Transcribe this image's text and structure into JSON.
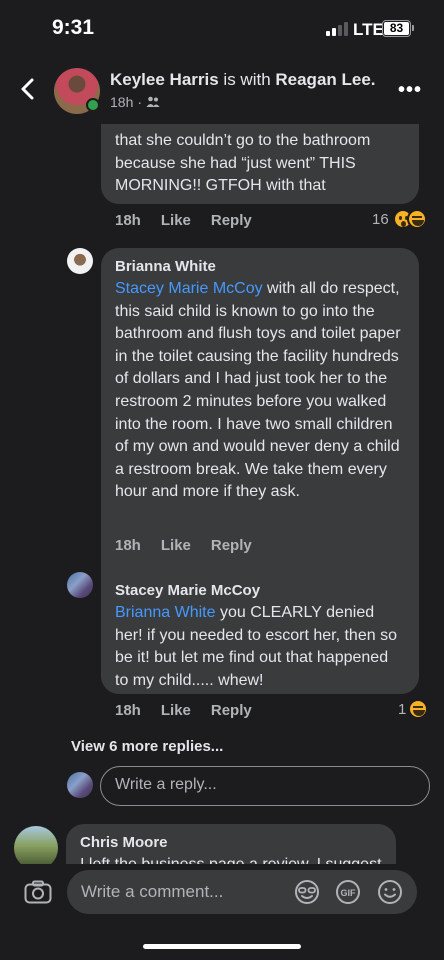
{
  "status": {
    "time": "9:31",
    "network": "LTE",
    "battery": "83"
  },
  "header": {
    "author": "Keylee Harris",
    "with_text": " is with ",
    "tagged": "Reagan Lee.",
    "time": "18h",
    "separator": "·",
    "audience_icon": "friends-icon",
    "more_icon": "ellipsis-icon"
  },
  "comments": [
    {
      "partial_text": "that she couldn’t go to the bathroom because she had “just went” THIS MORNING!! GTFOH with that",
      "time": "18h",
      "like": "Like",
      "reply": "Reply",
      "reaction_count": "16",
      "reactions": [
        "wow",
        "haha"
      ]
    },
    {
      "author": "Brianna White",
      "mention": "Stacey Marie McCoy",
      "text": " with all do respect, this said child is known to go into the bathroom and flush toys and toilet paper in the toilet causing the facility hundreds of dollars and I had just took her to the restroom 2 minutes before you walked into the room. I have two small children of my own and would never deny a child a restroom break. We take them every hour and more if they ask.",
      "time": "18h",
      "like": "Like",
      "reply": "Reply"
    },
    {
      "author": "Stacey Marie McCoy",
      "mention": "Brianna White",
      "text": " you CLEARLY denied her!  if you needed to escort her, then so be it! but let me find out that happened to my child..... whew!",
      "time": "18h",
      "like": "Like",
      "reply": "Reply",
      "reaction_count": "1",
      "reactions": [
        "haha"
      ]
    }
  ],
  "view_more": "View 6 more replies...",
  "reply_placeholder": "Write a reply...",
  "next_comment": {
    "author": "Chris Moore",
    "partial_text": "I left the business page a review. I suggest"
  },
  "composer": {
    "placeholder": "Write a comment...",
    "gif_label": "GIF"
  }
}
